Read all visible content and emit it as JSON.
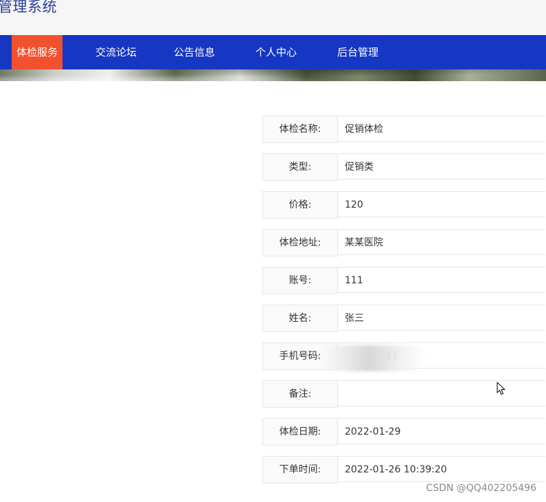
{
  "header": {
    "title": "管理系统"
  },
  "nav": {
    "items": [
      {
        "label": "体检服务",
        "active": true
      },
      {
        "label": "交流论坛",
        "active": false
      },
      {
        "label": "公告信息",
        "active": false
      },
      {
        "label": "个人中心",
        "active": false
      },
      {
        "label": "后台管理",
        "active": false
      }
    ]
  },
  "details": {
    "rows": [
      {
        "label": "体检名称:",
        "value": "促销体检"
      },
      {
        "label": "类型:",
        "value": "促销类"
      },
      {
        "label": "价格:",
        "value": "120"
      },
      {
        "label": "体检地址:",
        "value": "某某医院"
      },
      {
        "label": "账号:",
        "value": "111"
      },
      {
        "label": "姓名:",
        "value": "张三"
      },
      {
        "label": "手机号码:",
        "value": "11"
      },
      {
        "label": "备注:",
        "value": ""
      },
      {
        "label": "体检日期:",
        "value": "2022-01-29"
      },
      {
        "label": "下单时间:",
        "value": "2022-01-26 10:39:20"
      }
    ]
  },
  "watermark": {
    "text": "CSDN @QQ402205496"
  },
  "colors": {
    "nav_bg": "#1537c4",
    "nav_active": "#f1512e",
    "title": "#2a3b9a"
  }
}
